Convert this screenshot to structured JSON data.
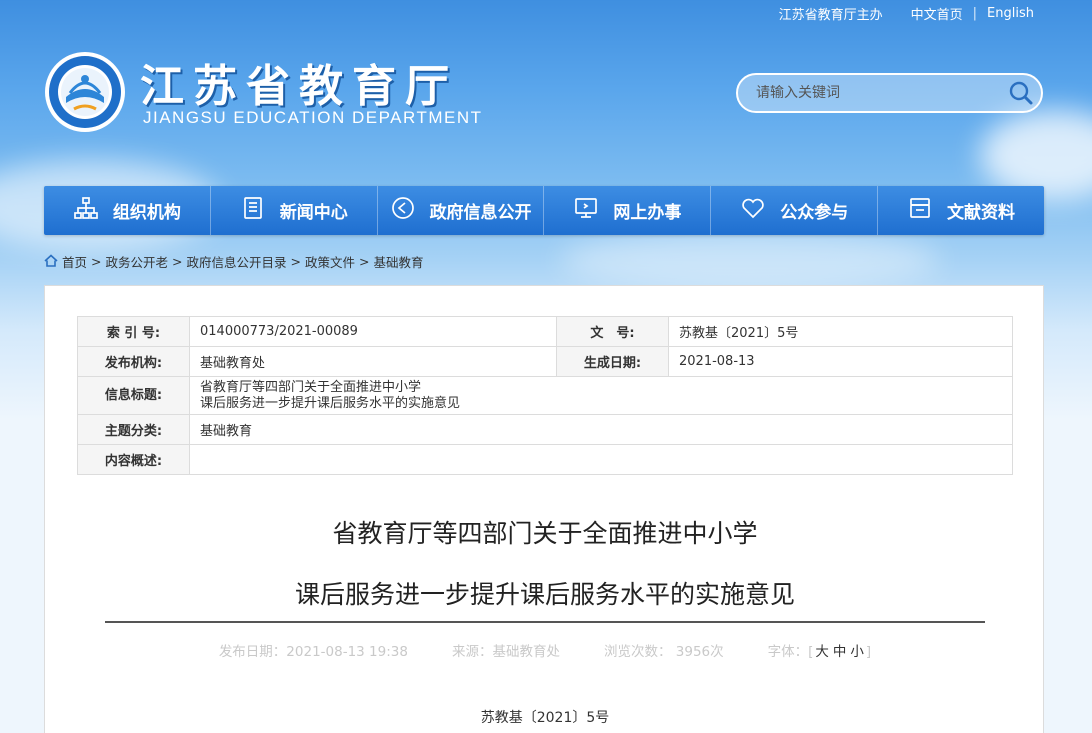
{
  "topbar": {
    "sponsor": "江苏省教育厅主办",
    "home": "中文首页",
    "sep": "|",
    "english": "English"
  },
  "header": {
    "title": "江苏省教育厅",
    "subtitle": "JIANGSU EDUCATION DEPARTMENT"
  },
  "search": {
    "placeholder": "请输入关键词"
  },
  "nav": [
    {
      "label": "组织机构",
      "icon": "org-chart-icon"
    },
    {
      "label": "新闻中心",
      "icon": "document-icon"
    },
    {
      "label": "政府信息公开",
      "icon": "megaphone-icon"
    },
    {
      "label": "网上办事",
      "icon": "monitor-icon"
    },
    {
      "label": "公众参与",
      "icon": "heart-icon"
    },
    {
      "label": "文献资料",
      "icon": "archive-icon"
    }
  ],
  "breadcrumb": [
    {
      "label": "首页"
    },
    {
      "label": "政务公开老"
    },
    {
      "label": "政府信息公开目录"
    },
    {
      "label": "政策文件"
    },
    {
      "label": "基础教育"
    }
  ],
  "meta": {
    "index_label": "索 引 号:",
    "index_value": "014000773/2021-00089",
    "docno_label": "文　号:",
    "docno_value": "苏教基〔2021〕5号",
    "org_label": "发布机构:",
    "org_value": "基础教育处",
    "date_label": "生成日期:",
    "date_value": "2021-08-13",
    "title_label": "信息标题:",
    "title_line1": "省教育厅等四部门关于全面推进中小学",
    "title_line2": "课后服务进一步提升课后服务水平的实施意见",
    "topic_label": "主题分类:",
    "topic_value": "基础教育",
    "summary_label": "内容概述:",
    "summary_value": ""
  },
  "article": {
    "title_line1": "省教育厅等四部门关于全面推进中小学",
    "title_line2": "课后服务进一步提升课后服务水平的实施意见",
    "publish": "发布日期：2021-08-13 19:38",
    "source": "来源：基础教育处",
    "views": "浏览次数：  3956次",
    "font_label": "字体：",
    "bracket_open": "[",
    "size_large": "大",
    "size_medium": "中",
    "size_small": "小",
    "bracket_close": "]",
    "doc_number": "苏教基〔2021〕5号"
  },
  "colors": {
    "nav_bg": "#2a7ddb",
    "accent": "#1f6fd0"
  }
}
